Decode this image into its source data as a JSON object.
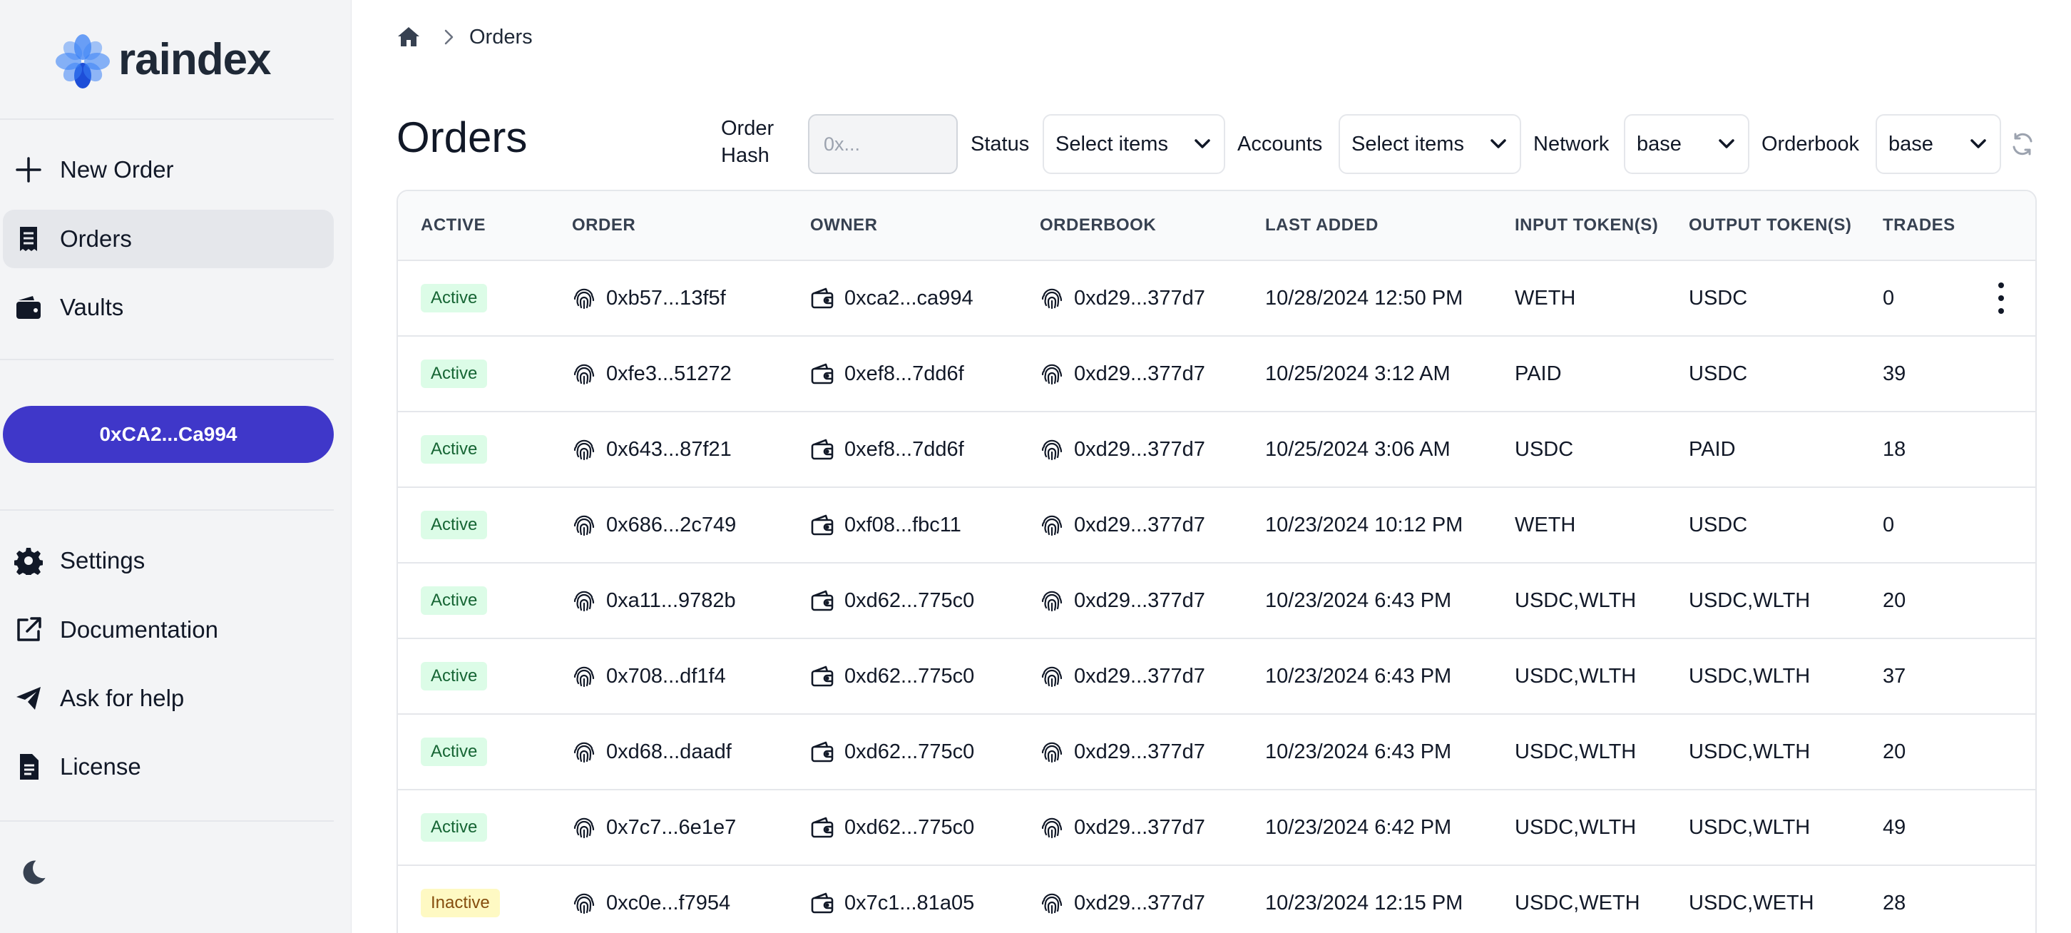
{
  "brand": {
    "name": "raindex"
  },
  "sidebar": {
    "items": [
      {
        "label": "New Order",
        "icon": "plus-icon"
      },
      {
        "label": "Orders",
        "icon": "receipt-icon",
        "active": true
      },
      {
        "label": "Vaults",
        "icon": "wallet-icon"
      }
    ],
    "wallet_button": "0xCA2...Ca994",
    "footer_items": [
      {
        "label": "Settings",
        "icon": "gear-icon"
      },
      {
        "label": "Documentation",
        "icon": "external-link-icon"
      },
      {
        "label": "Ask for help",
        "icon": "paper-plane-icon"
      },
      {
        "label": "License",
        "icon": "document-icon"
      }
    ],
    "theme_toggle_icon": "moon-icon"
  },
  "breadcrumb": {
    "home_icon": "home-icon",
    "current": "Orders"
  },
  "page": {
    "title": "Orders"
  },
  "filters": {
    "order_hash_label": "Order Hash",
    "order_hash_label_line1": "Order",
    "order_hash_label_line2": "Hash",
    "order_hash_placeholder": "0x...",
    "status_label": "Status",
    "status_value": "Select items",
    "accounts_label": "Accounts",
    "accounts_value": "Select items",
    "network_label": "Network",
    "network_value": "base",
    "orderbook_label": "Orderbook",
    "orderbook_value": "base",
    "refresh_icon": "refresh-icon"
  },
  "table": {
    "headers": [
      "ACTIVE",
      "ORDER",
      "OWNER",
      "ORDERBOOK",
      "LAST ADDED",
      "INPUT TOKEN(S)",
      "OUTPUT TOKEN(S)",
      "TRADES"
    ],
    "rows": [
      {
        "status": "Active",
        "order": "0xb57...13f5f",
        "owner": "0xca2...ca994",
        "orderbook": "0xd29...377d7",
        "last_added": "10/28/2024 12:50 PM",
        "input": "WETH",
        "output": "USDC",
        "trades": "0"
      },
      {
        "status": "Active",
        "order": "0xfe3...51272",
        "owner": "0xef8...7dd6f",
        "orderbook": "0xd29...377d7",
        "last_added": "10/25/2024 3:12 AM",
        "input": "PAID",
        "output": "USDC",
        "trades": "39"
      },
      {
        "status": "Active",
        "order": "0x643...87f21",
        "owner": "0xef8...7dd6f",
        "orderbook": "0xd29...377d7",
        "last_added": "10/25/2024 3:06 AM",
        "input": "USDC",
        "output": "PAID",
        "trades": "18"
      },
      {
        "status": "Active",
        "order": "0x686...2c749",
        "owner": "0xf08...fbc11",
        "orderbook": "0xd29...377d7",
        "last_added": "10/23/2024 10:12 PM",
        "input": "WETH",
        "output": "USDC",
        "trades": "0"
      },
      {
        "status": "Active",
        "order": "0xa11...9782b",
        "owner": "0xd62...775c0",
        "orderbook": "0xd29...377d7",
        "last_added": "10/23/2024 6:43 PM",
        "input": "USDC,WLTH",
        "output": "USDC,WLTH",
        "trades": "20"
      },
      {
        "status": "Active",
        "order": "0x708...df1f4",
        "owner": "0xd62...775c0",
        "orderbook": "0xd29...377d7",
        "last_added": "10/23/2024 6:43 PM",
        "input": "USDC,WLTH",
        "output": "USDC,WLTH",
        "trades": "37"
      },
      {
        "status": "Active",
        "order": "0xd68...daadf",
        "owner": "0xd62...775c0",
        "orderbook": "0xd29...377d7",
        "last_added": "10/23/2024 6:43 PM",
        "input": "USDC,WLTH",
        "output": "USDC,WLTH",
        "trades": "20"
      },
      {
        "status": "Active",
        "order": "0x7c7...6e1e7",
        "owner": "0xd62...775c0",
        "orderbook": "0xd29...377d7",
        "last_added": "10/23/2024 6:42 PM",
        "input": "USDC,WLTH",
        "output": "USDC,WLTH",
        "trades": "49"
      },
      {
        "status": "Inactive",
        "order": "0xc0e...f7954",
        "owner": "0x7c1...81a05",
        "orderbook": "0xd29...377d7",
        "last_added": "10/23/2024 12:15 PM",
        "input": "USDC,WETH",
        "output": "USDC,WETH",
        "trades": "28"
      }
    ],
    "row_menu_icon": "kebab-menu-icon"
  },
  "colors": {
    "accent": "#3f37c9",
    "sidebar_bg": "#f3f4f6",
    "active_badge_bg": "#dcfce7",
    "active_badge_text": "#166534",
    "inactive_badge_bg": "#fef9c3",
    "inactive_badge_text": "#854d0e",
    "logo_blue": "#3b82f6"
  }
}
